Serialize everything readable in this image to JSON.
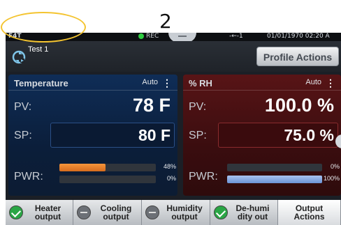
{
  "step_number": "2",
  "status_bar": {
    "brand": "F4T",
    "rec_label": "REC",
    "network": "-←-1",
    "datetime": "01/01/1970 02:20 A"
  },
  "profile": {
    "name": "Test 1",
    "actions_label": "Profile Actions"
  },
  "panels": {
    "temperature": {
      "title": "Temperature",
      "mode": "Auto",
      "pv_label": "PV:",
      "pv_value": "78 F",
      "sp_label": "SP:",
      "sp_value": "80 F",
      "pwr_label": "PWR:",
      "pwr1_percent": 48,
      "pwr1_label": "48%",
      "pwr2_percent": 0,
      "pwr2_label": "0%"
    },
    "humidity": {
      "title": "% RH",
      "mode": "Auto",
      "pv_label": "PV:",
      "pv_value": "100.0 %",
      "sp_label": "SP:",
      "sp_value": "75.0 %",
      "pwr_label": "PWR:",
      "pwr1_percent": 0,
      "pwr1_label": "0%",
      "pwr2_percent": 100,
      "pwr2_label": "100%"
    }
  },
  "outputs": [
    {
      "label": "Heater\noutput",
      "state": "on"
    },
    {
      "label": "Cooling\noutput",
      "state": "off"
    },
    {
      "label": "Humidity\noutput",
      "state": "off"
    },
    {
      "label": "De-humi\ndity out",
      "state": "on"
    }
  ],
  "output_actions_label": "Output\nActions",
  "colors": {
    "highlight": "#f4c430",
    "heat_bar": "#f5963b",
    "humidity_bar": "#8fb0e6",
    "output_on": "#2aa645",
    "output_off": "#6c7076"
  }
}
